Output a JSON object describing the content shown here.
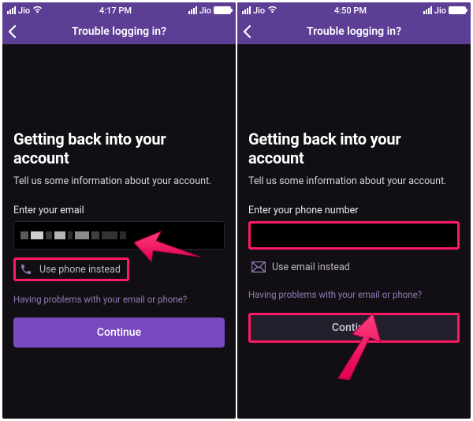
{
  "left": {
    "status": {
      "carrier": "Jio",
      "time": "4:17 PM",
      "right_carrier": "Jio"
    },
    "nav": {
      "title": "Trouble logging in?"
    },
    "heading": "Getting back into your account",
    "subheading": "Tell us some information about your account.",
    "field_label": "Enter your email",
    "alt_label": "Use phone instead",
    "problems": "Having problems with your email or phone?",
    "continue": "Continue"
  },
  "right": {
    "status": {
      "carrier": "Jio",
      "time": "4:50 PM",
      "right_carrier": "Jio"
    },
    "nav": {
      "title": "Trouble logging in?"
    },
    "heading": "Getting back into your account",
    "subheading": "Tell us some information about your account.",
    "field_label": "Enter your phone number",
    "alt_label": "Use email instead",
    "problems": "Having problems with your email or phone?",
    "continue": "Continue"
  },
  "annotations": {
    "highlight_color": "#ff1a66",
    "arrow_color": "#ff1a66"
  }
}
